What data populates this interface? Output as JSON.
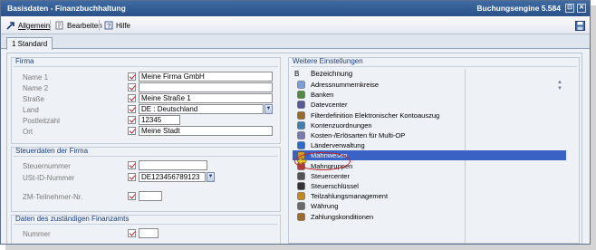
{
  "window": {
    "title": "Basisdaten - Finanzbuchhaltung",
    "engine": "Buchungsengine 5.584",
    "btn_restore": "⊡",
    "btn_close": "✕"
  },
  "toolbar": {
    "allgemein": "Allgemein",
    "bearbeiten": "Bearbeiten",
    "hilfe": "Hilfe"
  },
  "tabs": [
    {
      "label": "1 Standard"
    }
  ],
  "firma": {
    "title": "Firma",
    "fields": [
      {
        "label": "Name 1",
        "value": "Meine Firma GmbH"
      },
      {
        "label": "Name 2",
        "value": ""
      },
      {
        "label": "Straße",
        "value": "Meine Straße 1"
      },
      {
        "label": "Land",
        "value": "DE   : Deutschland"
      },
      {
        "label": "Postleitzahl",
        "value": "12345"
      },
      {
        "label": "Ort",
        "value": "Meine Stadt"
      }
    ]
  },
  "steuer": {
    "title": "Steuerdaten der Firma",
    "fields": [
      {
        "label": "Steuernummer",
        "value": ""
      },
      {
        "label": "USt-ID-Nummer",
        "value": "DE123456789123"
      },
      {
        "label": "ZM-Teilnehmer-Nr.",
        "value": ""
      }
    ]
  },
  "finanzamt": {
    "title": "Daten des zuständigen Finanzamts",
    "fields": [
      {
        "label": "Nummer",
        "value": ""
      }
    ]
  },
  "weitere": {
    "title": "Weitere Einstellungen",
    "col_b": "B",
    "col_bez": "Bezeichnung",
    "items": [
      {
        "label": "Adressnummernkreise",
        "icon": "number-range-icon"
      },
      {
        "label": "Banken",
        "icon": "bank-icon"
      },
      {
        "label": "Datevcenter",
        "icon": "datev-icon"
      },
      {
        "label": "Filterdefinition Elektronischer Kontoauszug",
        "icon": "filter-icon"
      },
      {
        "label": "Kontenzuordnungen",
        "icon": "account-mapping-icon"
      },
      {
        "label": "Kosten-/Erlösarten für Multi-OP",
        "icon": "cost-types-icon"
      },
      {
        "label": "Länderverwaltung",
        "icon": "globe-icon"
      },
      {
        "label": "Mahnwesen",
        "icon": "dunning-icon"
      },
      {
        "label": "Mahngruppen",
        "icon": "dunning-groups-icon"
      },
      {
        "label": "Steuercenter",
        "icon": "tax-center-icon"
      },
      {
        "label": "Steuerschlüssel",
        "icon": "tax-key-icon"
      },
      {
        "label": "Teilzahlungsmanagement",
        "icon": "installment-icon"
      },
      {
        "label": "Währung",
        "icon": "currency-icon"
      },
      {
        "label": "Zahlungskonditionen",
        "icon": "payment-terms-icon"
      }
    ],
    "selected": "Mahnwesen"
  },
  "colors": {
    "title_bar": "#2f5a93",
    "selection": "#3a62c4",
    "annotation": "#c0242c"
  }
}
